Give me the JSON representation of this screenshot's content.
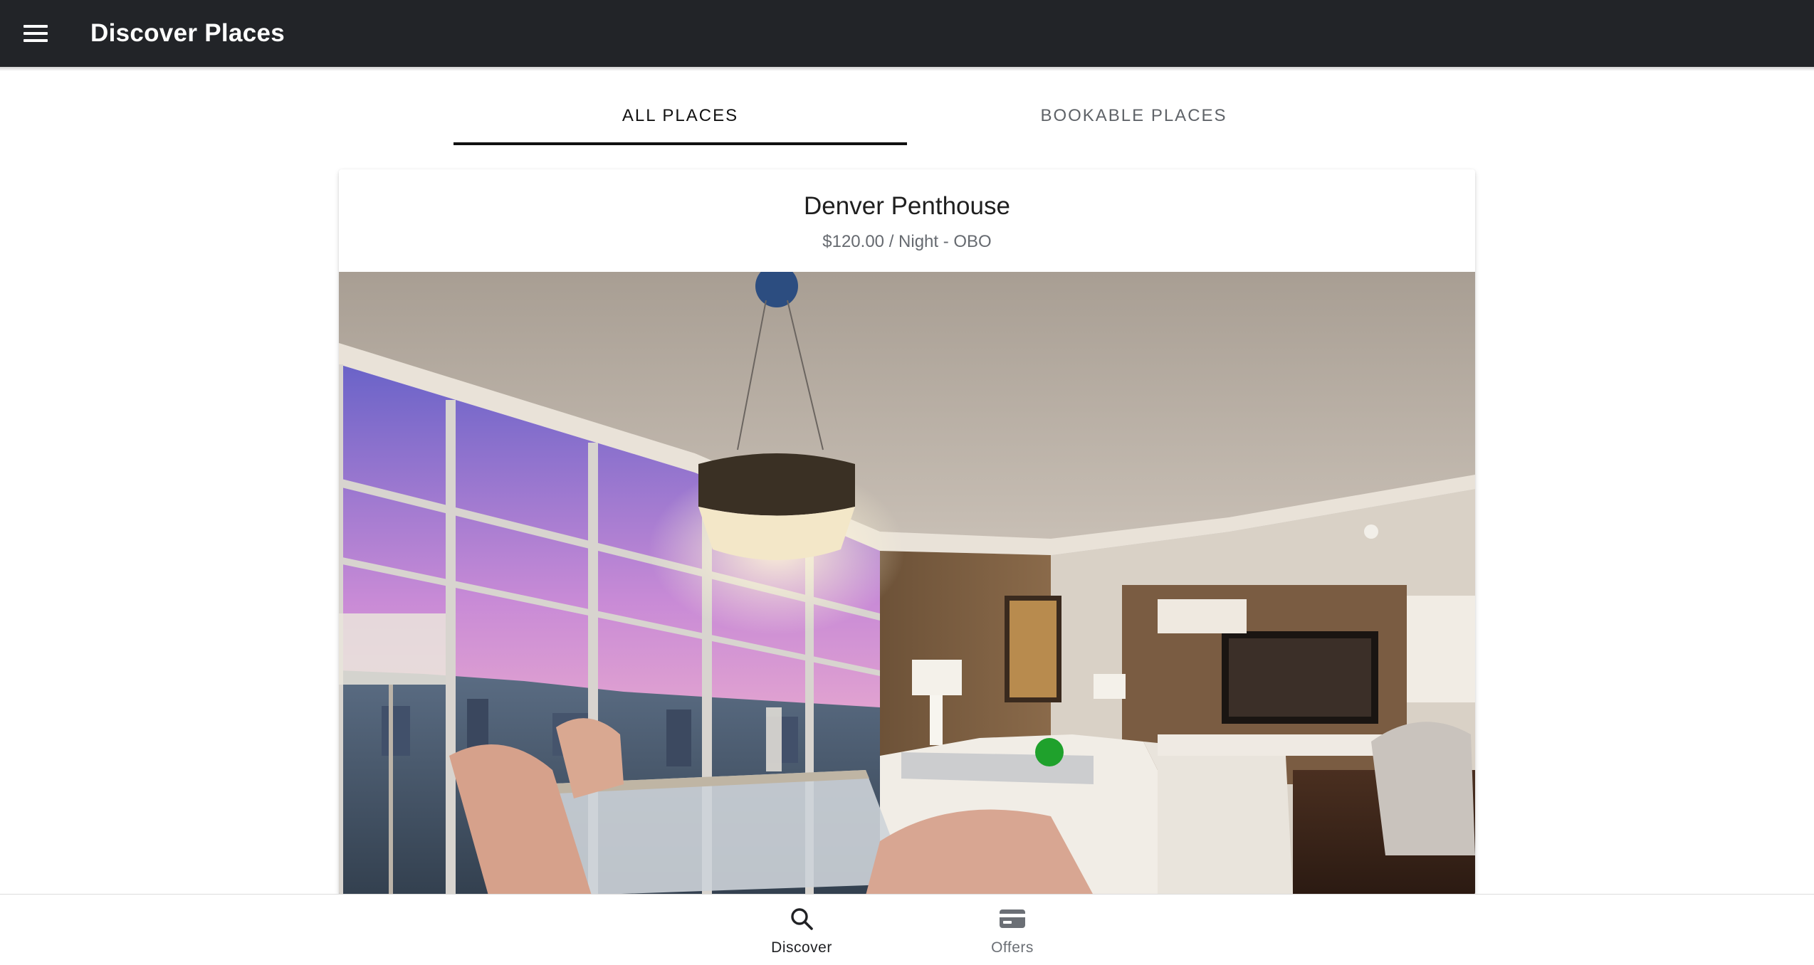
{
  "toolbar": {
    "title": "Discover Places",
    "menu_icon": "menu-icon",
    "background": "#222428"
  },
  "segment": {
    "tabs": [
      {
        "label": "ALL PLACES",
        "active": true
      },
      {
        "label": "BOOKABLE PLACES",
        "active": false
      }
    ]
  },
  "place": {
    "title": "Denver Penthouse",
    "subtitle": "$120.00 / Night - OBO",
    "image_icon": "penthouse-photo"
  },
  "tabbar": {
    "tabs": [
      {
        "label": "Discover",
        "icon": "search-icon",
        "active": true
      },
      {
        "label": "Offers",
        "icon": "card-icon",
        "active": false
      }
    ]
  }
}
